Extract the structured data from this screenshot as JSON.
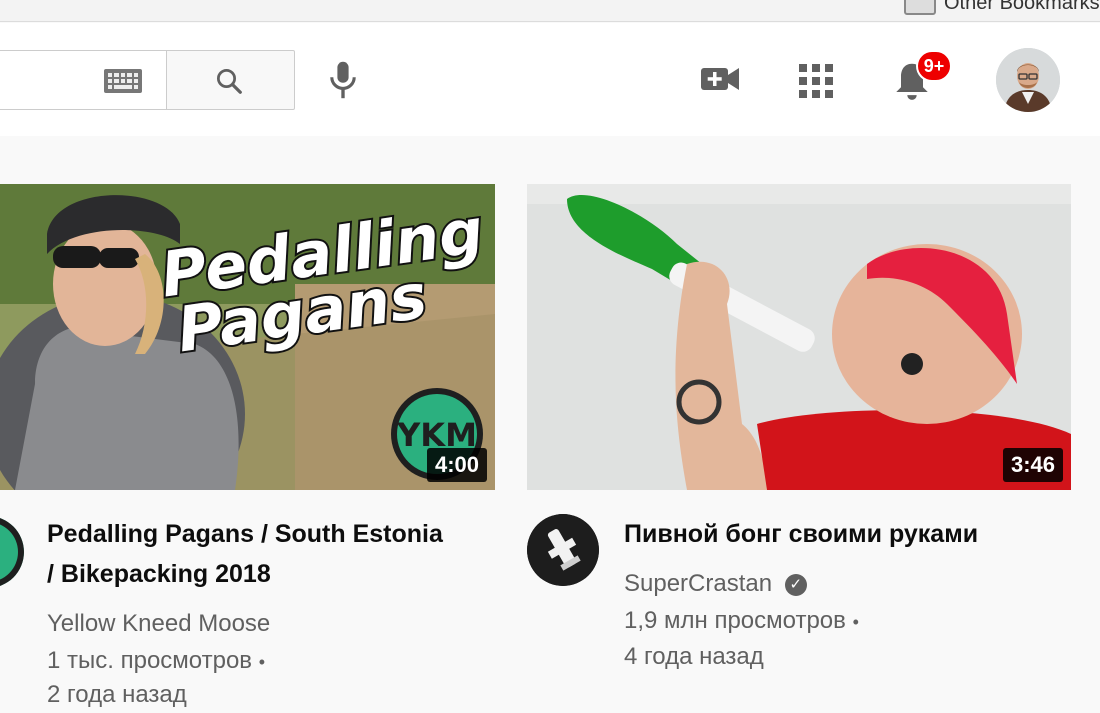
{
  "bookmarks": {
    "folder_label": "Other Bookmarks"
  },
  "masthead": {
    "notifications_badge": "9+"
  },
  "videos": [
    {
      "title": "Pedalling Pagans / South Estonia / Bikepacking 2018",
      "channel": "Yellow Kneed Moose",
      "views": "1 тыс. просмотров",
      "separator": "•",
      "age": "2 года назад",
      "duration": "4:00",
      "thumb_text_line1": "Pedalling",
      "thumb_text_line2": "Pagans",
      "badge_text": "YKM"
    },
    {
      "title": "Пивной бонг своими руками",
      "channel": "SuperCrastan",
      "verified": true,
      "views": "1,9 млн просмотров",
      "separator": "•",
      "age": "4 года назад",
      "duration": "3:46"
    }
  ],
  "colors": {
    "badge_red": "#e00000",
    "icon_gray": "#606060",
    "text_secondary": "#606060"
  },
  "icons": [
    "keyboard-icon",
    "search-icon",
    "mic-icon",
    "video-camera-plus-icon",
    "apps-grid-icon",
    "bell-icon",
    "verified-icon"
  ]
}
